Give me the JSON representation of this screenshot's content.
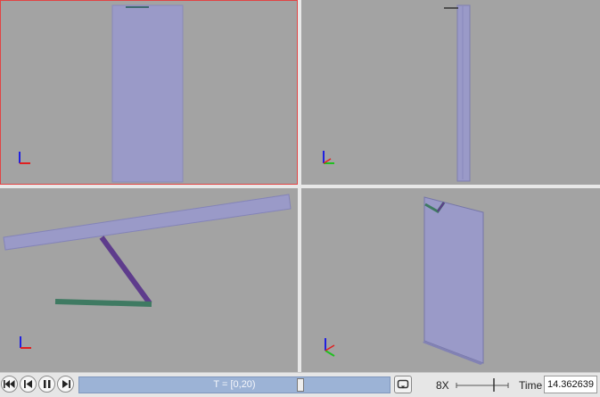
{
  "viewports": [
    {
      "name": "viewport-top-left",
      "active": true
    },
    {
      "name": "viewport-top-right",
      "active": false
    },
    {
      "name": "viewport-bottom-left",
      "active": false
    },
    {
      "name": "viewport-bottom-right",
      "active": false
    }
  ],
  "playback": {
    "controls": [
      {
        "name": "skip-to-start-icon"
      },
      {
        "name": "step-back-icon"
      },
      {
        "name": "pause-icon"
      },
      {
        "name": "step-forward-icon"
      }
    ],
    "timeline_label": "T = [0,20)",
    "timeline_progress": 0.718,
    "loop_icon": "loop-icon",
    "speed_label": "8X",
    "time_label": "Time",
    "time_value": "14.362639"
  },
  "colors": {
    "viewport_bg": "#a3a3a3",
    "active_border": "#e04444",
    "plate": "#9a9ac8",
    "link_purple": "#5e3c8c",
    "link_green": "#3f7a62",
    "axis_x": "#e02020",
    "axis_y": "#20c020",
    "axis_z": "#2020e0"
  }
}
